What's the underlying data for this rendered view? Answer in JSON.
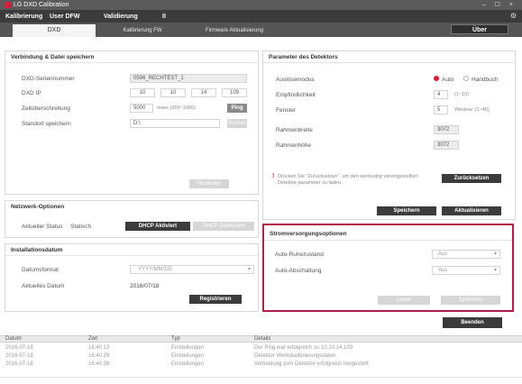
{
  "window": {
    "title": "LG DXD Calibration",
    "controls": "– ☐ ×"
  },
  "menu": {
    "items": [
      "Kalibrierung",
      "User DFW",
      "Validierung",
      "II"
    ]
  },
  "tabs": {
    "items": [
      "DXD",
      "Kalibrierung FW",
      "Firmware Aktualisierung"
    ],
    "about_label": "Über"
  },
  "connection": {
    "title": "Verbindung & Datei speichern",
    "serial_label": "DXD-Seriennummer",
    "serial_value": "0596_RECHTEST_1",
    "ip_label": "DXD IP",
    "ip_octets": [
      "10",
      "10",
      "14",
      "109"
    ],
    "time_label": "Zeitüberschreitung",
    "time_value": "5000",
    "time_unit": "msec (300~1000)",
    "ping_label": "Ping",
    "save_label": "Standort speichern",
    "save_value": "D:\\",
    "browse_label": "Suchen",
    "connect_label": "Verbinden"
  },
  "network": {
    "title": "Netzwerk-Optionen",
    "status_label": "Aktueller Status",
    "status_value": "Statisch",
    "dhcp_on_label": "DHCP Aktiviert",
    "dhcp_off_label": "DHCP Deaktiviert"
  },
  "install": {
    "title": "Installationsdatum",
    "format_label": "Datumsformat",
    "format_value": "YYYY/MM/DD",
    "current_label": "Aktuelles Datum",
    "current_value": "2016/07/18",
    "apply_label": "Registrieren"
  },
  "detector": {
    "title": "Parameter des Detektors",
    "trigger_label": "Auslösemodus",
    "trigger_options": [
      "Auto",
      "Handbuch"
    ],
    "sensitivity_label": "Empfindlichkeit",
    "sensitivity_value": "4",
    "sensitivity_range": "(1~10)",
    "window_label": "Fenster",
    "window_value": "5",
    "window_range": "Window: (1~40)",
    "width_label": "Rahmenbreite",
    "width_value": "3072",
    "height_label": "Rahmenhöhe",
    "height_value": "3072",
    "note": "Drücken Sie \"Zurücksetzen\", um den werkseitig voreingestellten Detektor-parameter zu laden.",
    "reset_label": "Zurücksetzen",
    "save_label": "Speichern",
    "refresh_label": "Aktualisieren"
  },
  "power": {
    "title": "Stromversorgungsoptionen",
    "sleep_label": "Auto-Ruhezustand",
    "sleep_value": "Aus",
    "off_label": "Auto-Abschaltung",
    "off_value": "Aus",
    "btn_left": "Lesen",
    "btn_right": "Speichern"
  },
  "footer": {
    "exit_label": "Beenden"
  },
  "log": {
    "headers": [
      "Datum",
      "Zeit",
      "Typ",
      "Details"
    ],
    "rows": [
      [
        "2016-07-18",
        "16:40:13",
        "Einstellungen",
        "Der Ping war erfolgreich zu 10.10.14.109"
      ],
      [
        "2016-07-18",
        "16:40:29",
        "Einstellungen",
        "Detektor Werkskalibrierungsdaten"
      ],
      [
        "2016-07-18",
        "16:40:38",
        "Einstellungen",
        "Verbindung zum Detektor erfolgreich hergestellt"
      ]
    ]
  },
  "colors": {
    "highlight": "#b0204a",
    "radio_selected": "#d21f3c",
    "dark_button": "#3c3c3c"
  }
}
